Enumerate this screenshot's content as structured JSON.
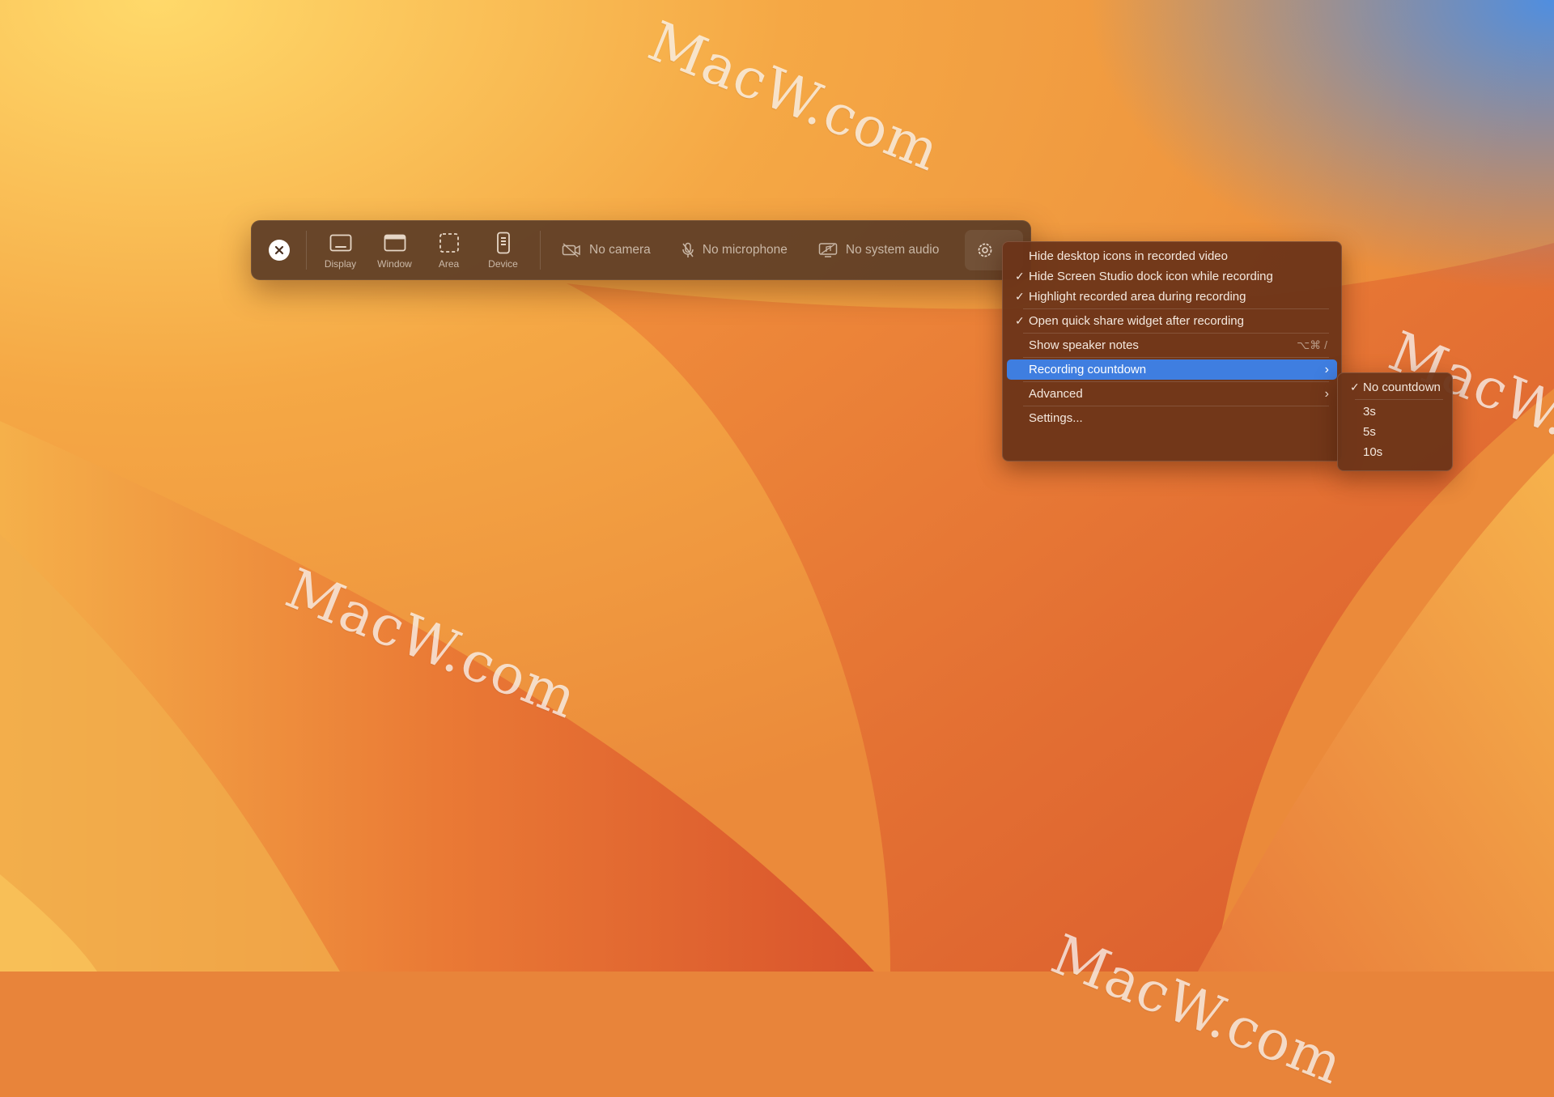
{
  "watermark": "MacW.com",
  "toolbar": {
    "modes": [
      {
        "label": "Display",
        "icon": "display-icon"
      },
      {
        "label": "Window",
        "icon": "window-icon"
      },
      {
        "label": "Area",
        "icon": "area-icon"
      },
      {
        "label": "Device",
        "icon": "device-icon"
      }
    ],
    "camera": "No camera",
    "microphone": "No microphone",
    "system_audio": "No system audio"
  },
  "menu": {
    "items": [
      {
        "label": "Hide desktop icons in recorded video",
        "checked": false
      },
      {
        "label": "Hide Screen Studio dock icon while recording",
        "checked": true
      },
      {
        "label": "Highlight recorded area during recording",
        "checked": true
      },
      {
        "label": "Open quick share widget after recording",
        "checked": true
      },
      {
        "label": "Show speaker notes",
        "shortcut": "⌥⌘ /"
      },
      {
        "label": "Recording countdown",
        "submenu": true,
        "highlighted": true
      },
      {
        "label": "Advanced",
        "submenu": true
      },
      {
        "label": "Settings..."
      }
    ],
    "check_glyph": "✓",
    "chevron_glyph": "›"
  },
  "countdown_submenu": {
    "items": [
      {
        "label": "No countdown",
        "checked": true
      },
      {
        "label": "3s"
      },
      {
        "label": "5s"
      },
      {
        "label": "10s"
      }
    ]
  },
  "colors": {
    "highlight": "#3f7ee0",
    "toolbar_bg": "#5c3c26",
    "menu_bg": "#6c3418"
  }
}
